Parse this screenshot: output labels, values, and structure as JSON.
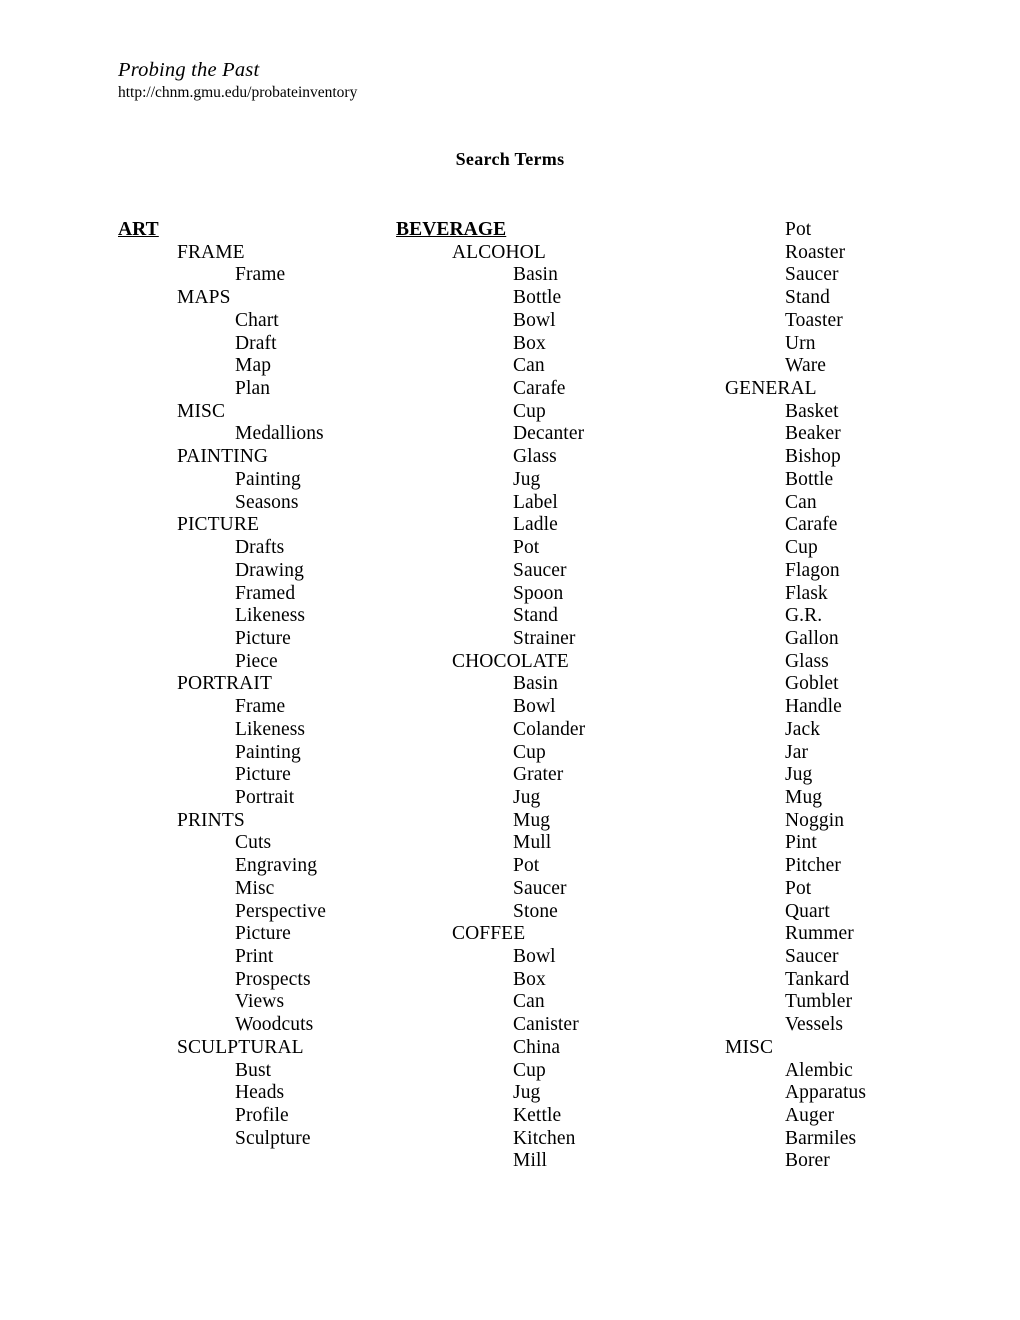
{
  "masthead": {
    "title": "Probing the Past",
    "url": "http://chnm.gmu.edu/probateinventory"
  },
  "doc_title": "Search Terms",
  "columns": [
    {
      "name": "column-1",
      "lines": [
        {
          "level": "group",
          "text": "ART"
        },
        {
          "level": "sub",
          "text": "FRAME"
        },
        {
          "level": "term",
          "text": "Frame"
        },
        {
          "level": "sub",
          "text": "MAPS"
        },
        {
          "level": "term",
          "text": "Chart"
        },
        {
          "level": "term",
          "text": "Draft"
        },
        {
          "level": "term",
          "text": "Map"
        },
        {
          "level": "term",
          "text": "Plan"
        },
        {
          "level": "sub",
          "text": "MISC"
        },
        {
          "level": "term",
          "text": "Medallions"
        },
        {
          "level": "sub",
          "text": "PAINTING"
        },
        {
          "level": "term",
          "text": "Painting"
        },
        {
          "level": "term",
          "text": "Seasons"
        },
        {
          "level": "sub",
          "text": "PICTURE"
        },
        {
          "level": "term",
          "text": "Drafts"
        },
        {
          "level": "term",
          "text": "Drawing"
        },
        {
          "level": "term",
          "text": "Framed"
        },
        {
          "level": "term",
          "text": "Likeness"
        },
        {
          "level": "term",
          "text": "Picture"
        },
        {
          "level": "term",
          "text": "Piece"
        },
        {
          "level": "sub",
          "text": "PORTRAIT"
        },
        {
          "level": "term",
          "text": "Frame"
        },
        {
          "level": "term",
          "text": "Likeness"
        },
        {
          "level": "term",
          "text": "Painting"
        },
        {
          "level": "term",
          "text": "Picture"
        },
        {
          "level": "term",
          "text": "Portrait"
        },
        {
          "level": "sub",
          "text": "PRINTS"
        },
        {
          "level": "term",
          "text": "Cuts"
        },
        {
          "level": "term",
          "text": "Engraving"
        },
        {
          "level": "term",
          "text": "Misc"
        },
        {
          "level": "term",
          "text": "Perspective"
        },
        {
          "level": "term",
          "text": "Picture"
        },
        {
          "level": "term",
          "text": "Print"
        },
        {
          "level": "term",
          "text": "Prospects"
        },
        {
          "level": "term",
          "text": "Views"
        },
        {
          "level": "term",
          "text": "Woodcuts"
        },
        {
          "level": "sub",
          "text": "SCULPTURAL"
        },
        {
          "level": "term",
          "text": "Bust"
        },
        {
          "level": "term",
          "text": "Heads"
        },
        {
          "level": "term",
          "text": "Profile"
        },
        {
          "level": "term",
          "text": "Sculpture"
        }
      ]
    },
    {
      "name": "column-2",
      "lines": [
        {
          "level": "group",
          "text": "BEVERAGE"
        },
        {
          "level": "sub",
          "text": "ALCOHOL"
        },
        {
          "level": "term",
          "text": "Basin"
        },
        {
          "level": "term",
          "text": "Bottle"
        },
        {
          "level": "term",
          "text": "Bowl"
        },
        {
          "level": "term",
          "text": "Box"
        },
        {
          "level": "term",
          "text": "Can"
        },
        {
          "level": "term",
          "text": "Carafe"
        },
        {
          "level": "term",
          "text": "Cup"
        },
        {
          "level": "term",
          "text": "Decanter"
        },
        {
          "level": "term",
          "text": "Glass"
        },
        {
          "level": "term",
          "text": "Jug"
        },
        {
          "level": "term",
          "text": "Label"
        },
        {
          "level": "term",
          "text": "Ladle"
        },
        {
          "level": "term",
          "text": "Pot"
        },
        {
          "level": "term",
          "text": "Saucer"
        },
        {
          "level": "term",
          "text": "Spoon"
        },
        {
          "level": "term",
          "text": "Stand"
        },
        {
          "level": "term",
          "text": "Strainer"
        },
        {
          "level": "sub",
          "text": "CHOCOLATE"
        },
        {
          "level": "term",
          "text": "Basin"
        },
        {
          "level": "term",
          "text": "Bowl"
        },
        {
          "level": "term",
          "text": "Colander"
        },
        {
          "level": "term",
          "text": "Cup"
        },
        {
          "level": "term",
          "text": "Grater"
        },
        {
          "level": "term",
          "text": "Jug"
        },
        {
          "level": "term",
          "text": "Mug"
        },
        {
          "level": "term",
          "text": "Mull"
        },
        {
          "level": "term",
          "text": "Pot"
        },
        {
          "level": "term",
          "text": "Saucer"
        },
        {
          "level": "term",
          "text": "Stone"
        },
        {
          "level": "sub",
          "text": "COFFEE"
        },
        {
          "level": "term",
          "text": "Bowl"
        },
        {
          "level": "term",
          "text": "Box"
        },
        {
          "level": "term",
          "text": "Can"
        },
        {
          "level": "term",
          "text": "Canister"
        },
        {
          "level": "term",
          "text": "China"
        },
        {
          "level": "term",
          "text": "Cup"
        },
        {
          "level": "term",
          "text": "Jug"
        },
        {
          "level": "term",
          "text": "Kettle"
        },
        {
          "level": "term",
          "text": "Kitchen"
        },
        {
          "level": "term",
          "text": "Mill"
        }
      ]
    },
    {
      "name": "column-3",
      "lines": [
        {
          "level": "term",
          "text": "Pot"
        },
        {
          "level": "term",
          "text": "Roaster"
        },
        {
          "level": "term",
          "text": "Saucer"
        },
        {
          "level": "term",
          "text": "Stand"
        },
        {
          "level": "term",
          "text": "Toaster"
        },
        {
          "level": "term",
          "text": "Urn"
        },
        {
          "level": "term",
          "text": "Ware"
        },
        {
          "level": "sub",
          "text": "GENERAL"
        },
        {
          "level": "term",
          "text": "Basket"
        },
        {
          "level": "term",
          "text": "Beaker"
        },
        {
          "level": "term",
          "text": "Bishop"
        },
        {
          "level": "term",
          "text": "Bottle"
        },
        {
          "level": "term",
          "text": "Can"
        },
        {
          "level": "term",
          "text": "Carafe"
        },
        {
          "level": "term",
          "text": "Cup"
        },
        {
          "level": "term",
          "text": "Flagon"
        },
        {
          "level": "term",
          "text": "Flask"
        },
        {
          "level": "term",
          "text": "G.R."
        },
        {
          "level": "term",
          "text": "Gallon"
        },
        {
          "level": "term",
          "text": "Glass"
        },
        {
          "level": "term",
          "text": "Goblet"
        },
        {
          "level": "term",
          "text": "Handle"
        },
        {
          "level": "term",
          "text": "Jack"
        },
        {
          "level": "term",
          "text": "Jar"
        },
        {
          "level": "term",
          "text": "Jug"
        },
        {
          "level": "term",
          "text": "Mug"
        },
        {
          "level": "term",
          "text": "Noggin"
        },
        {
          "level": "term",
          "text": "Pint"
        },
        {
          "level": "term",
          "text": "Pitcher"
        },
        {
          "level": "term",
          "text": "Pot"
        },
        {
          "level": "term",
          "text": "Quart"
        },
        {
          "level": "term",
          "text": "Rummer"
        },
        {
          "level": "term",
          "text": "Saucer"
        },
        {
          "level": "term",
          "text": "Tankard"
        },
        {
          "level": "term",
          "text": "Tumbler"
        },
        {
          "level": "term",
          "text": "Vessels"
        },
        {
          "level": "sub",
          "text": "MISC"
        },
        {
          "level": "term",
          "text": "Alembic"
        },
        {
          "level": "term",
          "text": "Apparatus"
        },
        {
          "level": "term",
          "text": "Auger"
        },
        {
          "level": "term",
          "text": "Barmiles"
        },
        {
          "level": "term",
          "text": "Borer"
        }
      ]
    }
  ]
}
